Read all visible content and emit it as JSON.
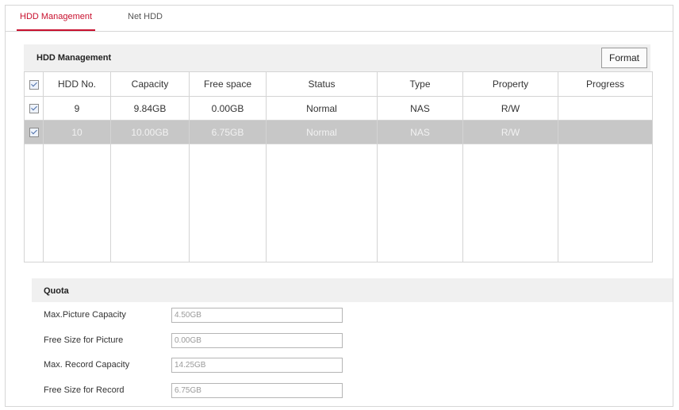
{
  "tabs": [
    {
      "label": "HDD Management"
    },
    {
      "label": "Net HDD"
    }
  ],
  "hdd_panel": {
    "title": "HDD Management",
    "format_label": "Format",
    "columns": [
      "HDD No.",
      "Capacity",
      "Free space",
      "Status",
      "Type",
      "Property",
      "Progress"
    ],
    "rows": [
      {
        "hdd_no": "9",
        "capacity": "9.84GB",
        "free_space": "0.00GB",
        "status": "Normal",
        "type": "NAS",
        "property": "R/W",
        "progress": ""
      },
      {
        "hdd_no": "10",
        "capacity": "10.00GB",
        "free_space": "6.75GB",
        "status": "Normal",
        "type": "NAS",
        "property": "R/W",
        "progress": ""
      }
    ]
  },
  "quota": {
    "title": "Quota",
    "fields": [
      {
        "label": "Max.Picture Capacity",
        "value": "4.50GB"
      },
      {
        "label": "Free Size for Picture",
        "value": "0.00GB"
      },
      {
        "label": "Max. Record Capacity",
        "value": "14.25GB"
      },
      {
        "label": "Free Size for Record",
        "value": "6.75GB"
      }
    ]
  }
}
